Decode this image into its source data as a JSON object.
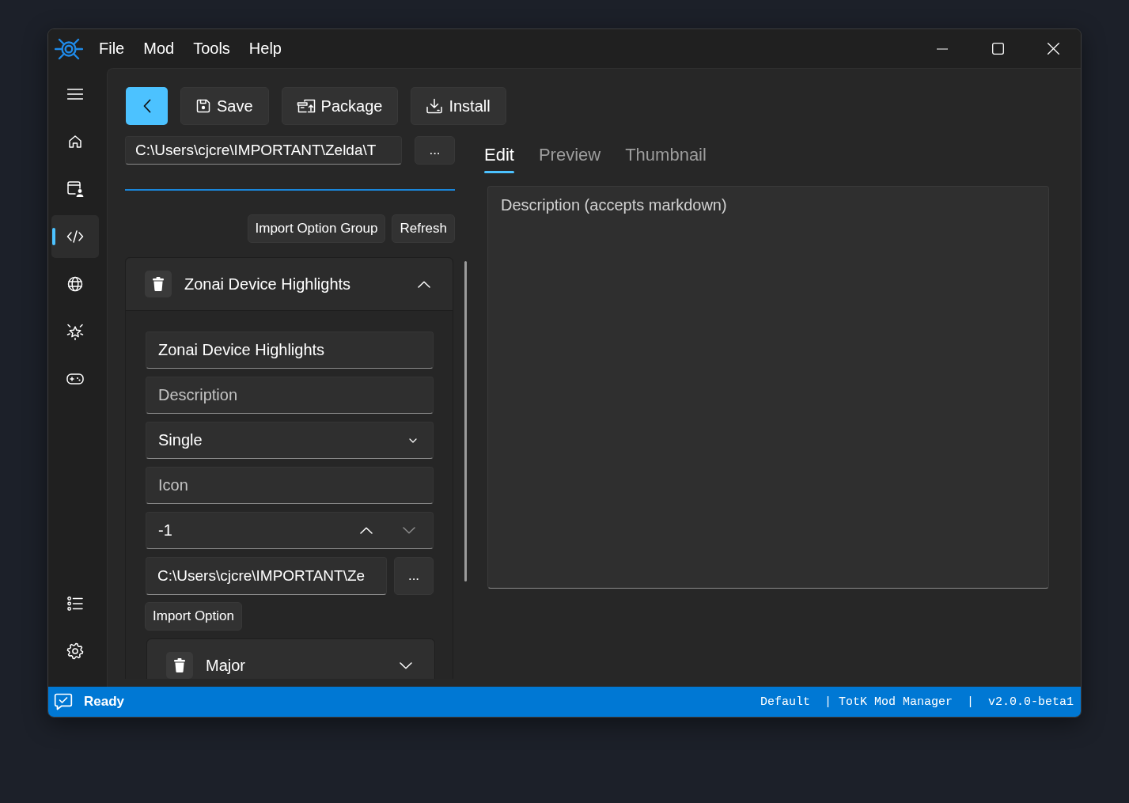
{
  "window": {
    "menu": [
      "File",
      "Mod",
      "Tools",
      "Help"
    ]
  },
  "sidebar": {
    "top_items": [
      {
        "selected": false
      },
      {
        "selected": false
      },
      {
        "selected": true
      },
      {
        "selected": false
      },
      {
        "selected": false
      },
      {
        "selected": false
      }
    ],
    "bottom_items": [
      {
        "selected": false
      },
      {
        "selected": false
      }
    ]
  },
  "toolbar": {
    "buttons": [
      {
        "label": "Save"
      },
      {
        "label": "Package"
      },
      {
        "label": "Install"
      }
    ]
  },
  "mod_folder": {
    "value": "C:\\Users\\cjcre\\IMPORTANT\\Zelda\\T",
    "browse_label": "..."
  },
  "group_actions": [
    "Import Option Group",
    "Refresh"
  ],
  "option_group": {
    "title": "Zonai Device Highlights",
    "expanded": true,
    "name_field": {
      "value": "Zonai Device Highlights"
    },
    "description_field": {
      "placeholder": "Description"
    },
    "type_combo": {
      "value": "Single"
    },
    "icon_field": {
      "placeholder": "Icon"
    },
    "priority_box": {
      "value": "-1",
      "up_disabled": false,
      "down_disabled": true
    },
    "path_field": {
      "value": "C:\\Users\\cjcre\\IMPORTANT\\Ze",
      "browse_label": "..."
    },
    "import_option_label": "Import Option",
    "options": [
      {
        "title": "Major",
        "expanded": false
      }
    ]
  },
  "editor": {
    "tabs": [
      {
        "label": "Edit",
        "selected": true
      },
      {
        "label": "Preview",
        "selected": false
      },
      {
        "label": "Thumbnail",
        "selected": false
      }
    ],
    "description": {
      "placeholder": "Description (accepts markdown)"
    }
  },
  "status_bar": {
    "message": "Ready",
    "segments": [
      "Default",
      "| TotK Mod Manager",
      "|",
      "v2.0.0-beta1"
    ]
  }
}
